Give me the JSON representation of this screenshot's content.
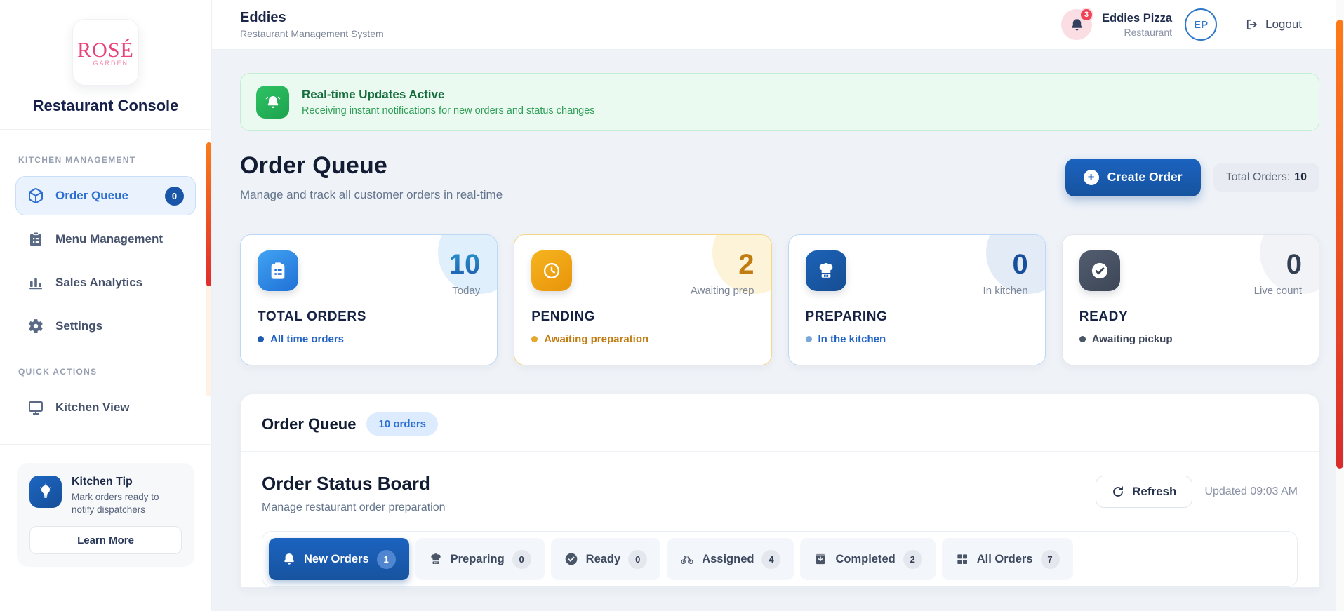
{
  "sidebar": {
    "logo_text": "ROSÉ",
    "logo_subtext": "GARDEN",
    "console_title": "Restaurant Console",
    "sections": [
      {
        "label": "KITCHEN MANAGEMENT",
        "items": [
          {
            "label": "Order Queue",
            "badge": "0",
            "icon": "package-icon",
            "active": true
          },
          {
            "label": "Menu Management",
            "icon": "clipboard-icon"
          },
          {
            "label": "Sales Analytics",
            "icon": "bar-chart-icon"
          },
          {
            "label": "Settings",
            "icon": "gear-icon"
          }
        ]
      },
      {
        "label": "QUICK ACTIONS",
        "items": [
          {
            "label": "Kitchen View",
            "icon": "monitor-icon"
          }
        ]
      }
    ],
    "tip": {
      "title": "Kitchen Tip",
      "text": "Mark orders ready to notify dispatchers",
      "button_label": "Learn More",
      "icon": "lightbulb-icon"
    }
  },
  "header": {
    "title": "Eddies",
    "subtitle": "Restaurant Management System",
    "notification_count": "3",
    "account_name": "Eddies Pizza",
    "account_type": "Restaurant",
    "avatar_initials": "EP",
    "logout_label": "Logout"
  },
  "banner": {
    "title": "Real-time Updates Active",
    "subtitle": "Receiving instant notifications for new orders and status changes",
    "icon": "bell-icon"
  },
  "page": {
    "title": "Order Queue",
    "subtitle": "Manage and track all customer orders in real-time",
    "create_order_label": "Create Order",
    "total_orders_label": "Total Orders:",
    "total_orders_value": "10"
  },
  "stats": [
    {
      "name": "TOTAL ORDERS",
      "value": "10",
      "value_caption": "Today",
      "status": "All time orders",
      "icon": "clipboard-icon",
      "theme": "blue"
    },
    {
      "name": "PENDING",
      "value": "2",
      "value_caption": "Awaiting prep",
      "status": "Awaiting preparation",
      "icon": "clock-icon",
      "theme": "amber"
    },
    {
      "name": "PREPARING",
      "value": "0",
      "value_caption": "In kitchen",
      "status": "In the kitchen",
      "icon": "chef-hat-icon",
      "theme": "darkblue"
    },
    {
      "name": "READY",
      "value": "0",
      "value_caption": "Live count",
      "status": "Awaiting pickup",
      "icon": "check-circle-icon",
      "theme": "slate"
    }
  ],
  "queue_panel": {
    "title": "Order Queue",
    "orders_badge": "10 orders",
    "board_title": "Order Status Board",
    "board_subtitle": "Manage restaurant order preparation",
    "refresh_label": "Refresh",
    "updated_label": "Updated 09:03 AM",
    "tabs": [
      {
        "label": "New Orders",
        "count": "1",
        "icon": "bell-icon",
        "active": true
      },
      {
        "label": "Preparing",
        "count": "0",
        "icon": "chef-hat-icon"
      },
      {
        "label": "Ready",
        "count": "0",
        "icon": "check-circle-icon"
      },
      {
        "label": "Assigned",
        "count": "4",
        "icon": "bike-icon"
      },
      {
        "label": "Completed",
        "count": "2",
        "icon": "archive-icon"
      },
      {
        "label": "All Orders",
        "count": "7",
        "icon": "grid-icon"
      }
    ]
  },
  "colors": {
    "primary_blue": "#1a5cb5",
    "active_blue_bg": "#eaf2fd",
    "green": "#22c55e",
    "green_bg": "#ebfaf0",
    "amber": "#f0a30a",
    "slate": "#475569",
    "notification_red": "#ef4456",
    "scrollbar_gradient_top": "#ff7a18",
    "scrollbar_gradient_bottom": "#d92b2b",
    "main_bg": "#eff3f8"
  }
}
